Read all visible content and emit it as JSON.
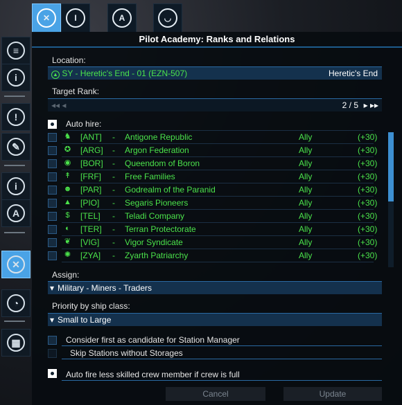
{
  "title": "Pilot Academy: Ranks and Relations",
  "location": {
    "label": "Location:",
    "value": "SY - Heretic's End - 01 (EZN-507)",
    "sector": "Heretic's End"
  },
  "target_rank": {
    "label": "Target Rank:",
    "page": "2 / 5"
  },
  "auto_hire": {
    "label": "Auto hire:",
    "checked": true,
    "factions": [
      {
        "code": "[ANT]",
        "dash": "-",
        "name": "Antigone Republic",
        "relation": "Ally",
        "value": "(+30)",
        "icon": "antigone-icon",
        "glyph": "♞"
      },
      {
        "code": "[ARG]",
        "dash": "-",
        "name": "Argon Federation",
        "relation": "Ally",
        "value": "(+30)",
        "icon": "argon-icon",
        "glyph": "✪"
      },
      {
        "code": "[BOR]",
        "dash": "-",
        "name": "Queendom of Boron",
        "relation": "Ally",
        "value": "(+30)",
        "icon": "boron-icon",
        "glyph": "◉"
      },
      {
        "code": "[FRF]",
        "dash": "-",
        "name": "Free Families",
        "relation": "Ally",
        "value": "(+30)",
        "icon": "free-families-icon",
        "glyph": "↟"
      },
      {
        "code": "[PAR]",
        "dash": "-",
        "name": "Godrealm of the Paranid",
        "relation": "Ally",
        "value": "(+30)",
        "icon": "paranid-icon",
        "glyph": "☻"
      },
      {
        "code": "[PIO]",
        "dash": "-",
        "name": "Segaris Pioneers",
        "relation": "Ally",
        "value": "(+30)",
        "icon": "pioneers-icon",
        "glyph": "▲"
      },
      {
        "code": "[TEL]",
        "dash": "-",
        "name": "Teladi Company",
        "relation": "Ally",
        "value": "(+30)",
        "icon": "teladi-icon",
        "glyph": "$"
      },
      {
        "code": "[TER]",
        "dash": "-",
        "name": "Terran Protectorate",
        "relation": "Ally",
        "value": "(+30)",
        "icon": "terran-icon",
        "glyph": "◐"
      },
      {
        "code": "[VIG]",
        "dash": "-",
        "name": "Vigor Syndicate",
        "relation": "Ally",
        "value": "(+30)",
        "icon": "vigor-icon",
        "glyph": "❦"
      },
      {
        "code": "[ZYA]",
        "dash": "-",
        "name": "Zyarth Patriarchy",
        "relation": "Ally",
        "value": "(+30)",
        "icon": "zyarth-icon",
        "glyph": "✺"
      }
    ]
  },
  "assign": {
    "label": "Assign:",
    "value": "Military - Miners - Traders"
  },
  "priority": {
    "label": "Priority by ship class:",
    "value": "Small to Large"
  },
  "options": {
    "station_manager": "Consider first as candidate for Station Manager",
    "skip_stations": "Skip Stations without Storages",
    "auto_fire": "Auto fire less skilled crew member if crew is full"
  },
  "buttons": {
    "cancel": "Cancel",
    "update": "Update"
  },
  "colors": {
    "accent": "#4aa3e6",
    "ally_green": "#4be34b",
    "bar_blue": "#14314d"
  },
  "icons": {
    "dropdown": "▾",
    "prev": "◂◂ ◂",
    "next": "▸ ▸▸"
  }
}
